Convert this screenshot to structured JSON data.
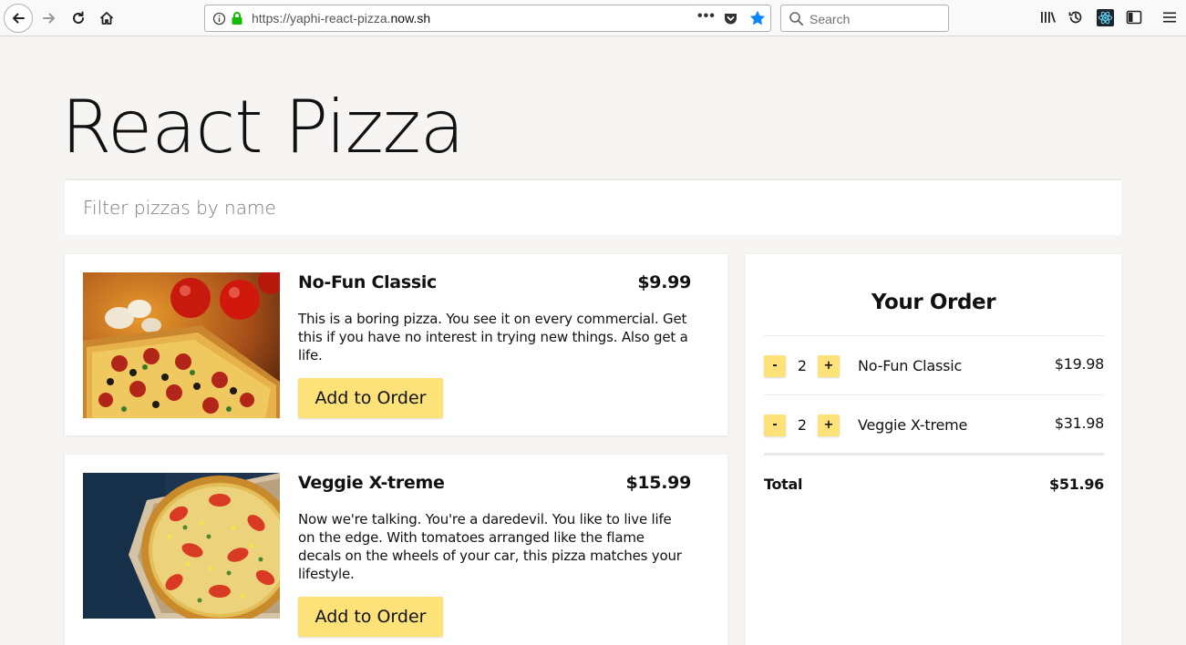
{
  "browser": {
    "url_prefix": "https://yaphi-react-pizza.",
    "url_host": "now.sh",
    "search_placeholder": "Search",
    "accent_color": "#0a84ff",
    "secure_color": "#12bc00"
  },
  "app": {
    "title": "React Pizza",
    "filter_placeholder": "Filter pizzas by name",
    "button_color": "#fde27a",
    "background_color": "#f6f5f3"
  },
  "pizzas": [
    {
      "name": "No-Fun Classic",
      "price": "$9.99",
      "description": "This is a boring pizza. You see it on every commercial. Get this if you have no interest in trying new things. Also get a life.",
      "button_label": "Add to Order",
      "image": "pizza-pepperoni-image"
    },
    {
      "name": "Veggie X-treme",
      "price": "$15.99",
      "description": "Now we're talking. You're a daredevil. You like to live life on the edge. With tomatoes arranged like the flame decals on the wheels of your car, this pizza matches your lifestyle.",
      "button_label": "Add to Order",
      "image": "pizza-veggie-image"
    }
  ],
  "order": {
    "title": "Your Order",
    "items": [
      {
        "minus_label": "-",
        "qty": "2",
        "plus_label": "+",
        "name": "No-Fun Classic",
        "price": "$19.98"
      },
      {
        "minus_label": "-",
        "qty": "2",
        "plus_label": "+",
        "name": "Veggie X-treme",
        "price": "$31.98"
      }
    ],
    "total_label": "Total",
    "total_value": "$51.96"
  }
}
